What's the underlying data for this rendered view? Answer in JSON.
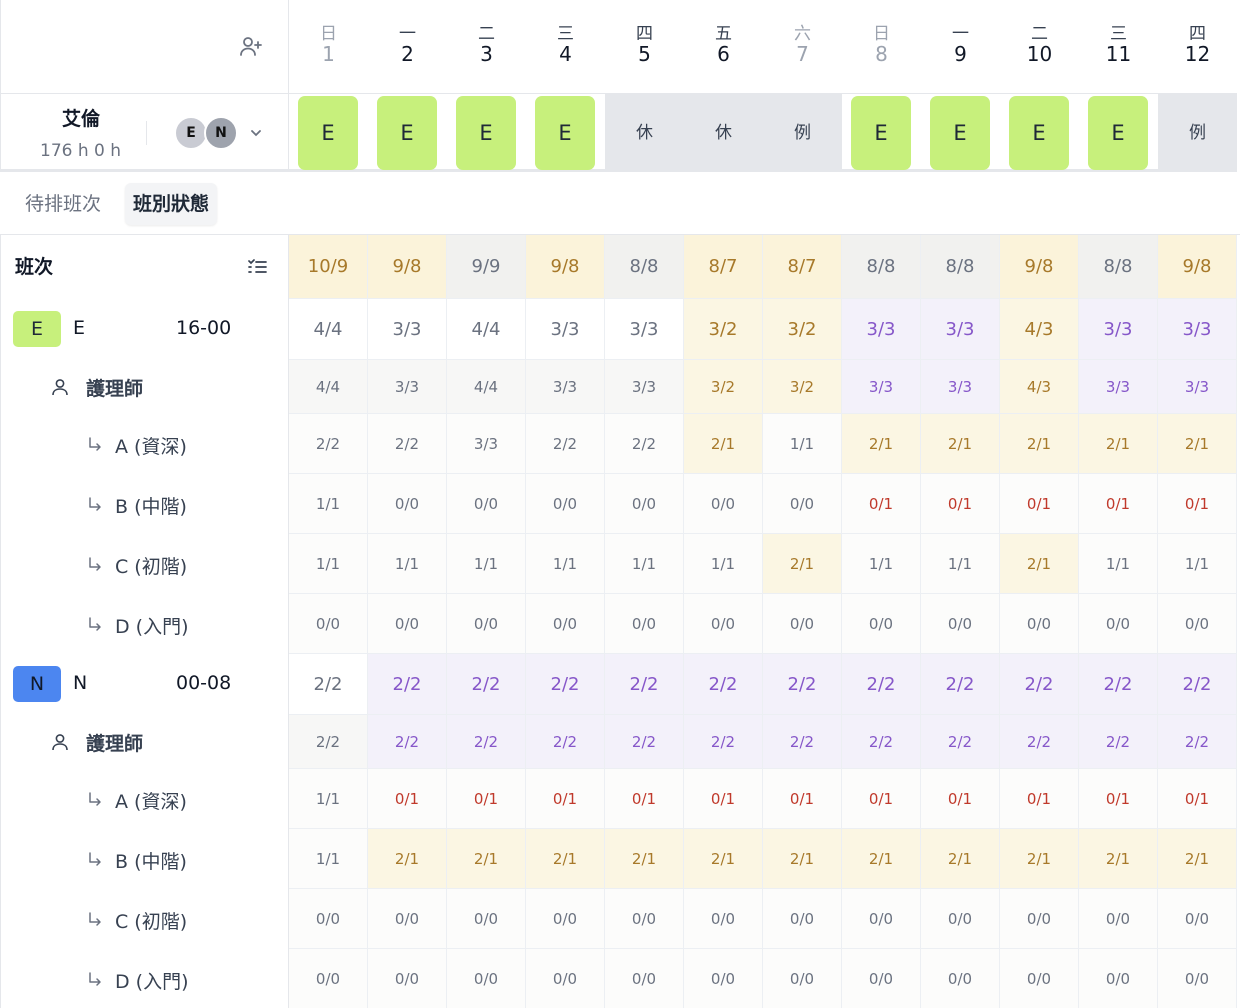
{
  "header": {
    "add_user_icon": "user-plus-icon",
    "days": [
      {
        "weekday": "日",
        "day": "1",
        "weekend": true
      },
      {
        "weekday": "一",
        "day": "2",
        "weekend": false
      },
      {
        "weekday": "二",
        "day": "3",
        "weekend": false
      },
      {
        "weekday": "三",
        "day": "4",
        "weekend": false
      },
      {
        "weekday": "四",
        "day": "5",
        "weekend": false
      },
      {
        "weekday": "五",
        "day": "6",
        "weekend": false
      },
      {
        "weekday": "六",
        "day": "7",
        "weekend": true
      },
      {
        "weekday": "日",
        "day": "8",
        "weekend": true
      },
      {
        "weekday": "一",
        "day": "9",
        "weekend": false
      },
      {
        "weekday": "二",
        "day": "10",
        "weekend": false
      },
      {
        "weekday": "三",
        "day": "11",
        "weekend": false
      },
      {
        "weekday": "四",
        "day": "12",
        "weekend": false
      }
    ]
  },
  "employee": {
    "name": "艾倫",
    "hours": "176 h   0 h",
    "avatars": [
      "E",
      "N"
    ],
    "schedule": [
      {
        "type": "shift",
        "label": "E"
      },
      {
        "type": "shift",
        "label": "E"
      },
      {
        "type": "shift",
        "label": "E"
      },
      {
        "type": "shift",
        "label": "E"
      },
      {
        "type": "off",
        "label": "休"
      },
      {
        "type": "off",
        "label": "休"
      },
      {
        "type": "off",
        "label": "例"
      },
      {
        "type": "shift",
        "label": "E"
      },
      {
        "type": "shift",
        "label": "E"
      },
      {
        "type": "shift",
        "label": "E"
      },
      {
        "type": "shift",
        "label": "E"
      },
      {
        "type": "off",
        "label": "例"
      }
    ]
  },
  "tabs": [
    {
      "label": "待排班次",
      "active": false
    },
    {
      "label": "班別狀態",
      "active": true
    }
  ],
  "table": {
    "title": "班次",
    "summary": [
      {
        "v": "10/9",
        "s": "over"
      },
      {
        "v": "9/8",
        "s": "over"
      },
      {
        "v": "9/9",
        "s": "neutral"
      },
      {
        "v": "9/8",
        "s": "over"
      },
      {
        "v": "8/8",
        "s": "neutral"
      },
      {
        "v": "8/7",
        "s": "over"
      },
      {
        "v": "8/7",
        "s": "over"
      },
      {
        "v": "8/8",
        "s": "neutral"
      },
      {
        "v": "8/8",
        "s": "neutral"
      },
      {
        "v": "9/8",
        "s": "over"
      },
      {
        "v": "8/8",
        "s": "neutral"
      },
      {
        "v": "9/8",
        "s": "over"
      }
    ],
    "shifts": [
      {
        "code": "E",
        "name": "E",
        "time": "16-00",
        "badge_bg": "#c7f07c",
        "badge_fg": "#1f2937",
        "totals": [
          {
            "v": "4/4",
            "s": "ok"
          },
          {
            "v": "3/3",
            "s": "ok"
          },
          {
            "v": "4/4",
            "s": "ok"
          },
          {
            "v": "3/3",
            "s": "ok"
          },
          {
            "v": "3/3",
            "s": "ok"
          },
          {
            "v": "3/2",
            "s": "over"
          },
          {
            "v": "3/2",
            "s": "over"
          },
          {
            "v": "3/3",
            "s": "purple"
          },
          {
            "v": "3/3",
            "s": "purple"
          },
          {
            "v": "4/3",
            "s": "over"
          },
          {
            "v": "3/3",
            "s": "purple"
          },
          {
            "v": "3/3",
            "s": "purple"
          }
        ],
        "role": {
          "name": "護理師",
          "values": [
            {
              "v": "4/4",
              "s": "ok"
            },
            {
              "v": "3/3",
              "s": "ok"
            },
            {
              "v": "4/4",
              "s": "ok"
            },
            {
              "v": "3/3",
              "s": "ok"
            },
            {
              "v": "3/3",
              "s": "ok"
            },
            {
              "v": "3/2",
              "s": "over"
            },
            {
              "v": "3/2",
              "s": "over"
            },
            {
              "v": "3/3",
              "s": "purple"
            },
            {
              "v": "3/3",
              "s": "purple"
            },
            {
              "v": "4/3",
              "s": "over"
            },
            {
              "v": "3/3",
              "s": "purple"
            },
            {
              "v": "3/3",
              "s": "purple"
            }
          ]
        },
        "levels": [
          {
            "name": "A (資深)",
            "values": [
              {
                "v": "2/2",
                "s": "ok"
              },
              {
                "v": "2/2",
                "s": "ok"
              },
              {
                "v": "3/3",
                "s": "ok"
              },
              {
                "v": "2/2",
                "s": "ok"
              },
              {
                "v": "2/2",
                "s": "ok"
              },
              {
                "v": "2/1",
                "s": "over"
              },
              {
                "v": "1/1",
                "s": "ok"
              },
              {
                "v": "2/1",
                "s": "over"
              },
              {
                "v": "2/1",
                "s": "over"
              },
              {
                "v": "2/1",
                "s": "over"
              },
              {
                "v": "2/1",
                "s": "over"
              },
              {
                "v": "2/1",
                "s": "over"
              }
            ]
          },
          {
            "name": "B (中階)",
            "values": [
              {
                "v": "1/1",
                "s": "ok"
              },
              {
                "v": "0/0",
                "s": "ok"
              },
              {
                "v": "0/0",
                "s": "ok"
              },
              {
                "v": "0/0",
                "s": "ok"
              },
              {
                "v": "0/0",
                "s": "ok"
              },
              {
                "v": "0/0",
                "s": "ok"
              },
              {
                "v": "0/0",
                "s": "ok"
              },
              {
                "v": "0/1",
                "s": "red"
              },
              {
                "v": "0/1",
                "s": "red"
              },
              {
                "v": "0/1",
                "s": "red"
              },
              {
                "v": "0/1",
                "s": "red"
              },
              {
                "v": "0/1",
                "s": "red"
              }
            ]
          },
          {
            "name": "C (初階)",
            "values": [
              {
                "v": "1/1",
                "s": "ok"
              },
              {
                "v": "1/1",
                "s": "ok"
              },
              {
                "v": "1/1",
                "s": "ok"
              },
              {
                "v": "1/1",
                "s": "ok"
              },
              {
                "v": "1/1",
                "s": "ok"
              },
              {
                "v": "1/1",
                "s": "ok"
              },
              {
                "v": "2/1",
                "s": "over"
              },
              {
                "v": "1/1",
                "s": "ok"
              },
              {
                "v": "1/1",
                "s": "ok"
              },
              {
                "v": "2/1",
                "s": "over"
              },
              {
                "v": "1/1",
                "s": "ok"
              },
              {
                "v": "1/1",
                "s": "ok"
              }
            ]
          },
          {
            "name": "D (入門)",
            "values": [
              {
                "v": "0/0",
                "s": "ok"
              },
              {
                "v": "0/0",
                "s": "ok"
              },
              {
                "v": "0/0",
                "s": "ok"
              },
              {
                "v": "0/0",
                "s": "ok"
              },
              {
                "v": "0/0",
                "s": "ok"
              },
              {
                "v": "0/0",
                "s": "ok"
              },
              {
                "v": "0/0",
                "s": "ok"
              },
              {
                "v": "0/0",
                "s": "ok"
              },
              {
                "v": "0/0",
                "s": "ok"
              },
              {
                "v": "0/0",
                "s": "ok"
              },
              {
                "v": "0/0",
                "s": "ok"
              },
              {
                "v": "0/0",
                "s": "ok"
              }
            ]
          }
        ]
      },
      {
        "code": "N",
        "name": "N",
        "time": "00-08",
        "badge_bg": "#4c86f0",
        "badge_fg": "#111827",
        "totals": [
          {
            "v": "2/2",
            "s": "ok"
          },
          {
            "v": "2/2",
            "s": "purple"
          },
          {
            "v": "2/2",
            "s": "purple"
          },
          {
            "v": "2/2",
            "s": "purple"
          },
          {
            "v": "2/2",
            "s": "purple"
          },
          {
            "v": "2/2",
            "s": "purple"
          },
          {
            "v": "2/2",
            "s": "purple"
          },
          {
            "v": "2/2",
            "s": "purple"
          },
          {
            "v": "2/2",
            "s": "purple"
          },
          {
            "v": "2/2",
            "s": "purple"
          },
          {
            "v": "2/2",
            "s": "purple"
          },
          {
            "v": "2/2",
            "s": "purple"
          }
        ],
        "role": {
          "name": "護理師",
          "values": [
            {
              "v": "2/2",
              "s": "ok"
            },
            {
              "v": "2/2",
              "s": "purple"
            },
            {
              "v": "2/2",
              "s": "purple"
            },
            {
              "v": "2/2",
              "s": "purple"
            },
            {
              "v": "2/2",
              "s": "purple"
            },
            {
              "v": "2/2",
              "s": "purple"
            },
            {
              "v": "2/2",
              "s": "purple"
            },
            {
              "v": "2/2",
              "s": "purple"
            },
            {
              "v": "2/2",
              "s": "purple"
            },
            {
              "v": "2/2",
              "s": "purple"
            },
            {
              "v": "2/2",
              "s": "purple"
            },
            {
              "v": "2/2",
              "s": "purple"
            }
          ]
        },
        "levels": [
          {
            "name": "A (資深)",
            "values": [
              {
                "v": "1/1",
                "s": "ok"
              },
              {
                "v": "0/1",
                "s": "red"
              },
              {
                "v": "0/1",
                "s": "red"
              },
              {
                "v": "0/1",
                "s": "red"
              },
              {
                "v": "0/1",
                "s": "red"
              },
              {
                "v": "0/1",
                "s": "red"
              },
              {
                "v": "0/1",
                "s": "red"
              },
              {
                "v": "0/1",
                "s": "red"
              },
              {
                "v": "0/1",
                "s": "red"
              },
              {
                "v": "0/1",
                "s": "red"
              },
              {
                "v": "0/1",
                "s": "red"
              },
              {
                "v": "0/1",
                "s": "red"
              }
            ]
          },
          {
            "name": "B (中階)",
            "values": [
              {
                "v": "1/1",
                "s": "ok"
              },
              {
                "v": "2/1",
                "s": "over"
              },
              {
                "v": "2/1",
                "s": "over"
              },
              {
                "v": "2/1",
                "s": "over"
              },
              {
                "v": "2/1",
                "s": "over"
              },
              {
                "v": "2/1",
                "s": "over"
              },
              {
                "v": "2/1",
                "s": "over"
              },
              {
                "v": "2/1",
                "s": "over"
              },
              {
                "v": "2/1",
                "s": "over"
              },
              {
                "v": "2/1",
                "s": "over"
              },
              {
                "v": "2/1",
                "s": "over"
              },
              {
                "v": "2/1",
                "s": "over"
              }
            ]
          },
          {
            "name": "C (初階)",
            "values": [
              {
                "v": "0/0",
                "s": "ok"
              },
              {
                "v": "0/0",
                "s": "ok"
              },
              {
                "v": "0/0",
                "s": "ok"
              },
              {
                "v": "0/0",
                "s": "ok"
              },
              {
                "v": "0/0",
                "s": "ok"
              },
              {
                "v": "0/0",
                "s": "ok"
              },
              {
                "v": "0/0",
                "s": "ok"
              },
              {
                "v": "0/0",
                "s": "ok"
              },
              {
                "v": "0/0",
                "s": "ok"
              },
              {
                "v": "0/0",
                "s": "ok"
              },
              {
                "v": "0/0",
                "s": "ok"
              },
              {
                "v": "0/0",
                "s": "ok"
              }
            ]
          },
          {
            "name": "D (入門)",
            "values": [
              {
                "v": "0/0",
                "s": "ok"
              },
              {
                "v": "0/0",
                "s": "ok"
              },
              {
                "v": "0/0",
                "s": "ok"
              },
              {
                "v": "0/0",
                "s": "ok"
              },
              {
                "v": "0/0",
                "s": "ok"
              },
              {
                "v": "0/0",
                "s": "ok"
              },
              {
                "v": "0/0",
                "s": "ok"
              },
              {
                "v": "0/0",
                "s": "ok"
              },
              {
                "v": "0/0",
                "s": "ok"
              },
              {
                "v": "0/0",
                "s": "ok"
              },
              {
                "v": "0/0",
                "s": "ok"
              },
              {
                "v": "0/0",
                "s": "ok"
              }
            ]
          }
        ]
      }
    ]
  }
}
